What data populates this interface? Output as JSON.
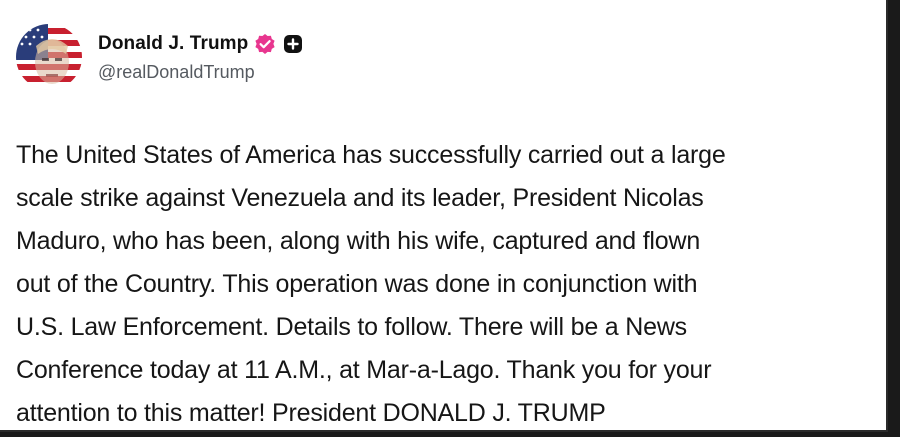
{
  "post": {
    "author": {
      "display_name": "Donald J. Trump",
      "handle": "@realDonaldTrump",
      "avatar_icon": "avatar-flag-portrait",
      "verified_icon": "verified-badge-icon",
      "verified_color": "#e8368f",
      "extra_icon": "plus-square-icon"
    },
    "text": "The United States of America has successfully carried out a large\nscale strike against Venezuela and its leader, President Nicolas\nMaduro, who has been, along with his wife, captured and flown\nout of the Country. This operation was done in conjunction with\nU.S. Law Enforcement. Details to follow. There will be a News\nConference today at 11 A.M., at Mar-a-Lago. Thank you for your\nattention to this matter! President DONALD J. TRUMP"
  }
}
